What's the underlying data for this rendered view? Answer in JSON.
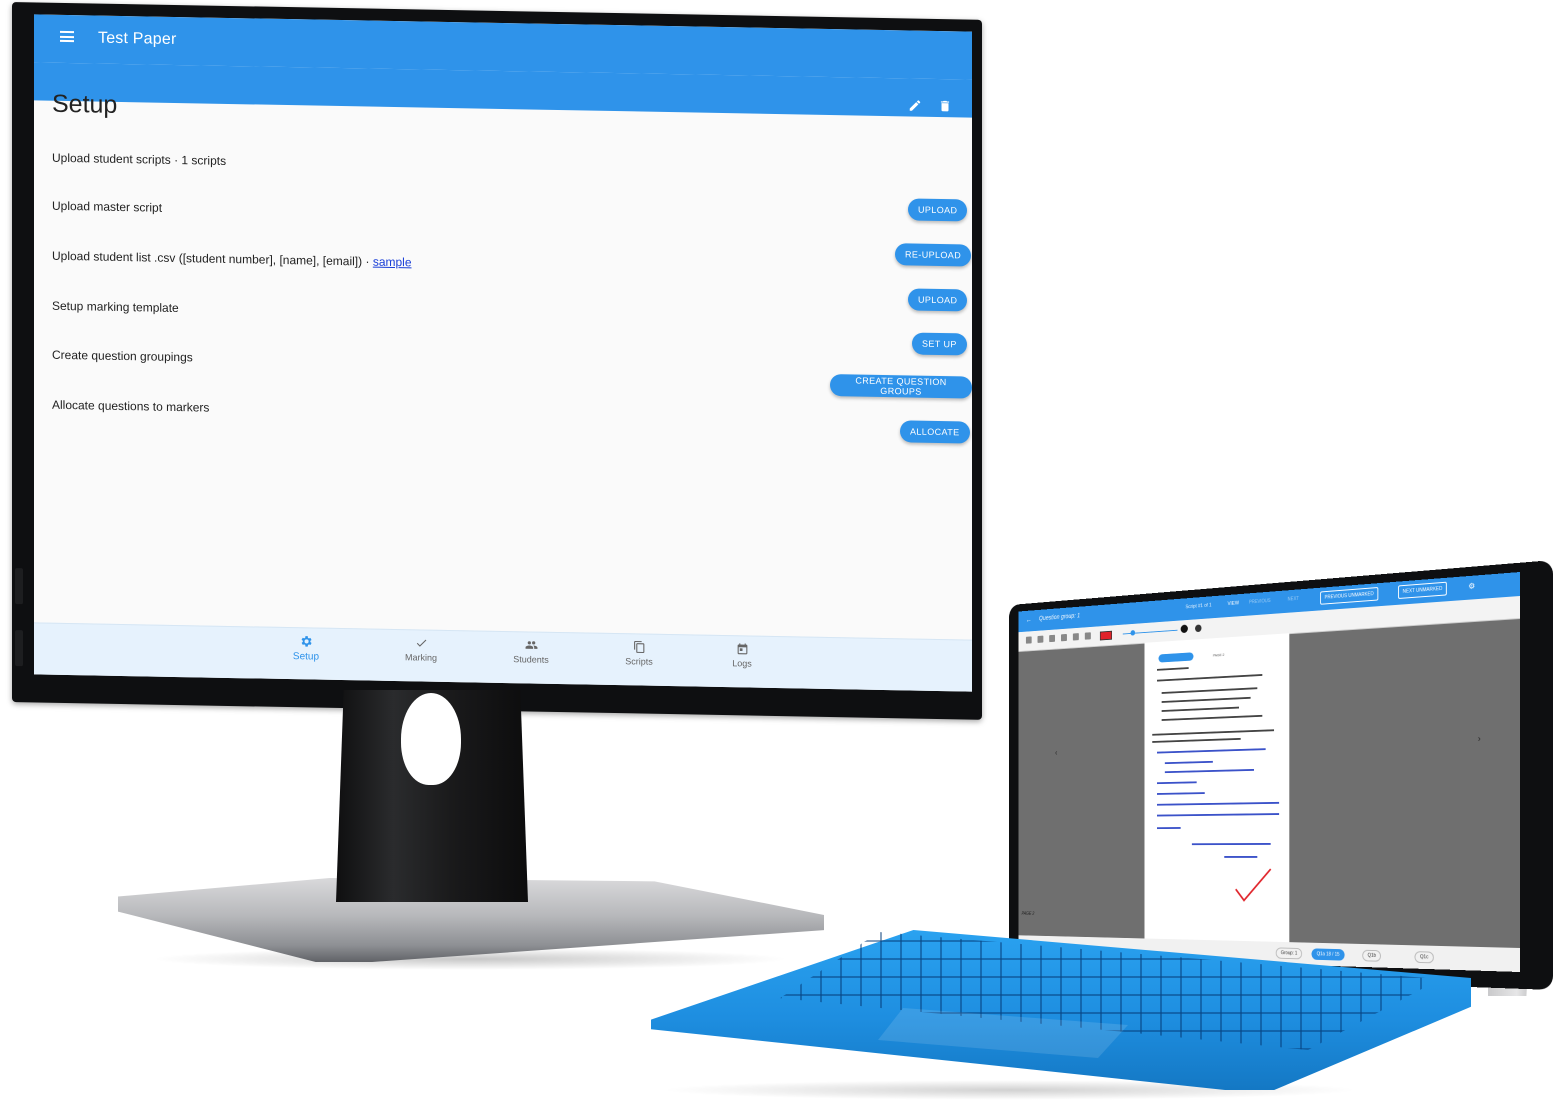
{
  "monitor": {
    "appbar": {
      "title": "Test Paper"
    },
    "page": {
      "title": "Setup"
    },
    "steps": [
      {
        "label": "Upload student scripts · 1 scripts",
        "button": "UPLOAD"
      },
      {
        "label": "Upload master script",
        "button": "RE-UPLOAD"
      },
      {
        "label_prefix": "Upload student list .csv ([student number], [name], [email]) · ",
        "link": "sample",
        "button": "UPLOAD"
      },
      {
        "label": "Setup marking template",
        "button": "SET UP"
      },
      {
        "label": "Create question groupings",
        "button": "CREATE QUESTION GROUPS"
      },
      {
        "label": "Allocate questions to markers",
        "button": "ALLOCATE"
      }
    ],
    "nav": [
      {
        "label": "Setup",
        "icon": "gear-icon",
        "active": true
      },
      {
        "label": "Marking",
        "icon": "check-icon",
        "active": false
      },
      {
        "label": "Students",
        "icon": "people-icon",
        "active": false
      },
      {
        "label": "Scripts",
        "icon": "files-icon",
        "active": false
      },
      {
        "label": "Logs",
        "icon": "calendar-icon",
        "active": false
      }
    ],
    "header_icons": [
      "edit-icon",
      "delete-icon"
    ],
    "colors": {
      "primary": "#2f93ea",
      "link": "#1a3fd8",
      "nav_bg": "#e6f2fd"
    }
  },
  "tablet": {
    "title": "Question group: 1",
    "script_info": "Script #1 of 1",
    "view": "VIEW",
    "previous": "PREVIOUS",
    "next": "NEXT",
    "previous_unmarked": "PREVIOUS UNMARKED",
    "next_unmarked": "NEXT UNMARKED",
    "page_label": "PAGE 2",
    "chip_page": "PAGE 2",
    "groups": [
      "Group: 1",
      "Q1a 18 / 15",
      "Q1b",
      "Q1c"
    ]
  }
}
